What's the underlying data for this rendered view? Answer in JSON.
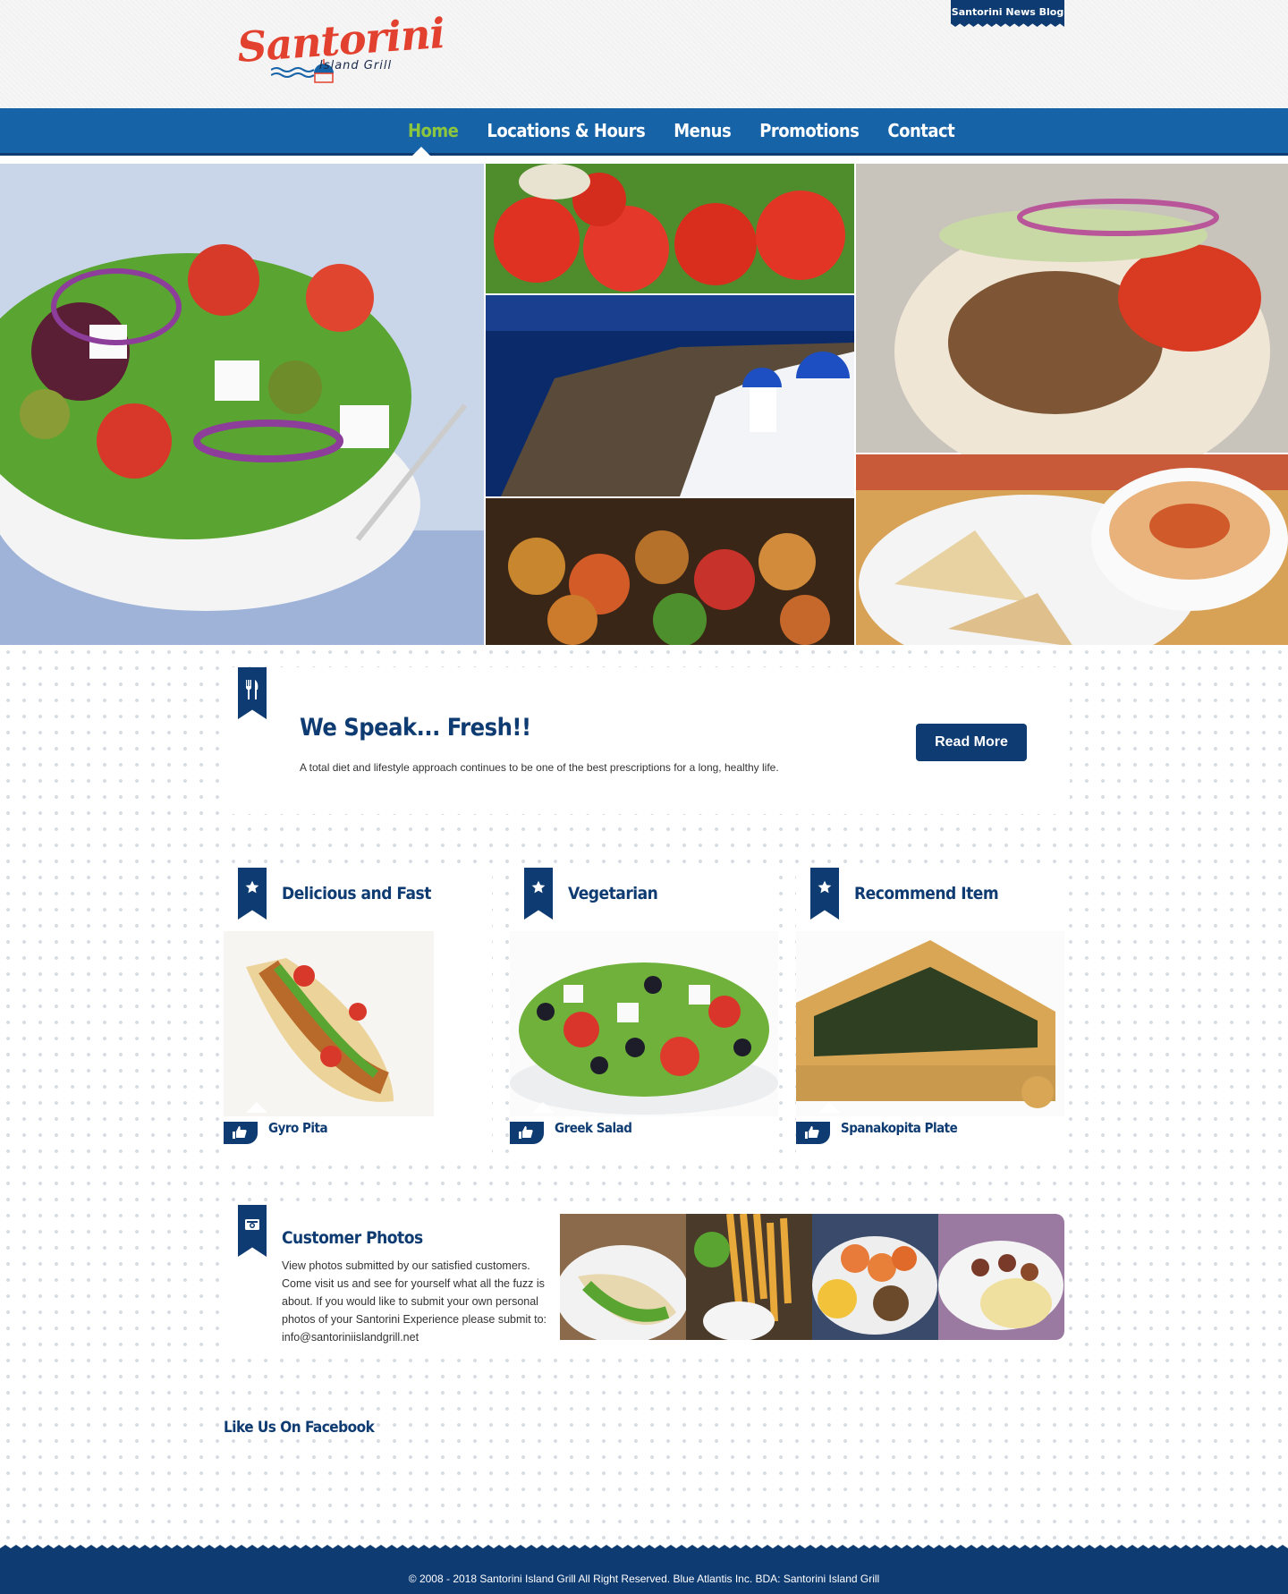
{
  "header": {
    "logo_alt": "Santorini Island Grill",
    "logo_word": "Santorini",
    "logo_sub": "Island Grill",
    "blog_link": "Santorini News Blog"
  },
  "nav": {
    "items": [
      {
        "label": "Home",
        "active": true
      },
      {
        "label": "Locations & Hours",
        "active": false
      },
      {
        "label": "Menus",
        "active": false
      },
      {
        "label": "Promotions",
        "active": false
      },
      {
        "label": "Contact",
        "active": false
      }
    ]
  },
  "intro": {
    "icon": "utensils-icon",
    "title": "We Speak... Fresh!!",
    "text": "A total diet and lifestyle approach continues to be one of the best prescriptions for a long, healthy life.",
    "button": "Read More"
  },
  "features": [
    {
      "icon": "star-icon",
      "title": "Delicious and Fast",
      "item": "Gyro Pita"
    },
    {
      "icon": "star-icon",
      "title": "Vegetarian",
      "item": "Greek Salad"
    },
    {
      "icon": "star-icon",
      "title": "Recommend Item",
      "item": "Spanakopita Plate"
    }
  ],
  "photos": {
    "icon": "camera-icon",
    "title": "Customer Photos",
    "text": "View photos submitted by our satisfied customers. Come visit us and see for yourself what all the fuzz is about. If you would like to submit your own personal photos of your Santorini Experience please submit to: info@santoriniislandgrill.net"
  },
  "facebook": {
    "title": "Like Us On Facebook"
  },
  "footer": {
    "text": "© 2008 - 2018 Santorini Island Grill All Right Reserved. Blue Atlantis Inc. BDA: Santorini Island Grill"
  },
  "colors": {
    "primary": "#0e3b72",
    "nav": "#1763a8",
    "active": "#8cc63f",
    "logo_red": "#e3412f"
  }
}
